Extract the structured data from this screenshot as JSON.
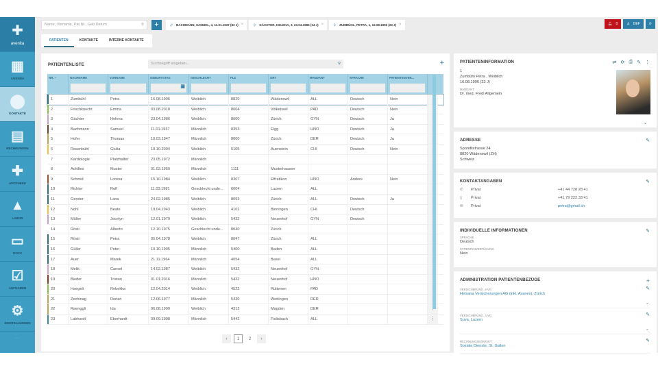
{
  "sidebar": {
    "logo": "avenita",
    "items": [
      {
        "label": "AGENDA",
        "icon": "calendar-icon",
        "glyph": "▦"
      },
      {
        "label": "KONTAKTE",
        "icon": "location-pin-icon",
        "glyph": "⬤",
        "active": true
      },
      {
        "label": "RECHNUNGEN",
        "icon": "calculator-icon",
        "glyph": "▤"
      },
      {
        "label": "APOTHEKE",
        "icon": "medical-cross-icon",
        "glyph": "✚"
      },
      {
        "label": "LABOR",
        "icon": "lab-chart-icon",
        "glyph": "▲"
      },
      {
        "label": "DOCS",
        "icon": "document-icon",
        "glyph": "▭"
      },
      {
        "label": "AUFGABEN",
        "icon": "task-checklist-icon",
        "glyph": "☑"
      },
      {
        "label": "EINSTELLUNGEN",
        "icon": "gear-icon",
        "glyph": "⚙"
      }
    ]
  },
  "topbar": {
    "search_placeholder": "Name, Vorname, Pat.Nr., Geb.Datum",
    "patient_tabs": [
      {
        "label": "BACHMANN, SAMUEL, 4, 11.01.1937 (83 J)",
        "gender": "♂"
      },
      {
        "label": "GÄCHTER, HELENA, 3, 23.04.1986 (34 J)",
        "gender": "♀"
      },
      {
        "label": "ZUMBÜHL, PETRA, 1, 16.08.1996 (23 J)",
        "gender": "♀"
      }
    ],
    "notifications": "0",
    "user": "DEF"
  },
  "subtabs": [
    "PATIENTEN",
    "KONTAKTE",
    "INTERNE KONTAKTE"
  ],
  "patientlist": {
    "title": "PATIENTENLISTE",
    "search_placeholder": "Suchbegriff eingeben...",
    "columns": [
      "NR.",
      "NACHNAME",
      "VORNAME",
      "GEBURTSTAG",
      "GESCHLECHT",
      "PLZ",
      "ORT",
      "MANDANT",
      "SPRACHE",
      "PATIENTENVER..."
    ],
    "rows": [
      [
        "1",
        "Zumbühl",
        "Petra",
        "16.08.1996",
        "Weiblich",
        "8820",
        "Wädenswil",
        "ALL",
        "Deutsch",
        "Nein",
        "#2e6f80"
      ],
      [
        "2",
        "Frischknecht",
        "Emma",
        "03.08.2018",
        "Weiblich",
        "8604",
        "Volketswil",
        "PAD",
        "Deutsch",
        "Nein",
        "#8bc34a"
      ],
      [
        "3",
        "Gächter",
        "Helena",
        "23.04.1986",
        "Weiblich",
        "8000",
        "Zürich",
        "GYN",
        "Deutsch",
        "Ja",
        "#c9a0c9"
      ],
      [
        "4",
        "Bachmann",
        "Samuel",
        "11.01.1937",
        "Männlich",
        "8353",
        "Elgg",
        "HNO",
        "Deutsch",
        "Ja",
        "#6e4420"
      ],
      [
        "5",
        "Hofer",
        "Thomas",
        "10.03.1947",
        "Männlich",
        "8000",
        "Zürich",
        "DER",
        "Deutsch",
        "Ja",
        "#c8a050"
      ],
      [
        "6",
        "Rosenbühl",
        "Giulia",
        "10.10.2004",
        "Weiblich",
        "5105",
        "Auenstein",
        "CHI",
        "Deutsch",
        "Nein",
        "#f0c040"
      ],
      [
        "7",
        "Kardiologie",
        "Platzhalter",
        "23.05.1972",
        "Männlich",
        "",
        "",
        "",
        "",
        "",
        ""
      ],
      [
        "8",
        "Achilles",
        "Muster",
        "01.02.1950",
        "Männlich",
        "1111",
        "Musterhausen",
        "",
        "",
        "",
        ""
      ],
      [
        "9",
        "Schmid",
        "Lorena",
        "15.10.1984",
        "Weiblich",
        "8307",
        "Effretikon",
        "HNO",
        "Andere",
        "Nein",
        "#a0522d"
      ],
      [
        "10",
        "Richter",
        "Rolf",
        "11.03.1981",
        "Geschlecht unde...",
        "6004",
        "Luzern",
        "ALL",
        "",
        "",
        "#2e6f80"
      ],
      [
        "11",
        "Gerster",
        "Lana",
        "24.02.1985",
        "Weiblich",
        "8093",
        "Zürich",
        "ALL",
        "Deutsch",
        "Ja",
        "#2e6f80"
      ],
      [
        "12",
        "Nohl",
        "Beate",
        "19.04.1943",
        "Weiblich",
        "4102",
        "Binningen",
        "CHI",
        "Deutsch",
        "",
        "#f0c040"
      ],
      [
        "13",
        "Müller",
        "Jocelyn",
        "12.01.1979",
        "Weiblich",
        "5432",
        "Neuenhof",
        "GYN",
        "Deutsch",
        "",
        "#c9a0c9"
      ],
      [
        "14",
        "Rösti",
        "Alberto",
        "12.10.1975",
        "Geschlecht unde...",
        "8040",
        "Zürich",
        "",
        "",
        "",
        ""
      ],
      [
        "15",
        "Rösti",
        "Petra",
        "05.04.1978",
        "Weiblich",
        "8047",
        "Zürich",
        "ALL",
        "",
        "",
        "#2e6f80"
      ],
      [
        "16",
        "Güller",
        "Peter",
        "10.10.1995",
        "Männlich",
        "5400",
        "Baden",
        "ALL",
        "",
        "",
        "#2e6f80"
      ],
      [
        "17",
        "Auer",
        "Marek",
        "21.11.1964",
        "Männlich",
        "4054",
        "Basel",
        "ALL",
        "",
        "",
        "#2e6f80"
      ],
      [
        "18",
        "Melik",
        "Cansel",
        "14.02.1987",
        "Weiblich",
        "5432",
        "Neuenhof",
        "GYN",
        "",
        "",
        "#d8a0c8"
      ],
      [
        "19",
        "Bieder",
        "Tristan",
        "01.01.2016",
        "Männlich",
        "5432",
        "Neuenhof",
        "HNO",
        "",
        "",
        "#8a3a1a"
      ],
      [
        "20",
        "Haegeli",
        "Rebekka",
        "12.04.2014",
        "Weiblich",
        "4522",
        "Rüttenen",
        "PAD",
        "",
        "",
        "#8bc34a"
      ],
      [
        "21",
        "Zechinag",
        "Dorian",
        "12.06.1977",
        "Männlich",
        "5430",
        "Wettingen",
        "DER",
        "",
        "",
        "#c8a050"
      ],
      [
        "22",
        "Raenggli",
        "Ida",
        "06.08.1990",
        "Weiblich",
        "4312",
        "Magden",
        "DER",
        "",
        "",
        "#c8a050"
      ],
      [
        "23",
        "Labhardt",
        "Eberhardt",
        "09.09.1998",
        "Männlich",
        "5442",
        "Fislisbach",
        "ALL",
        "",
        "",
        "#3a8aa0"
      ]
    ],
    "pages": [
      "1",
      "2"
    ],
    "current_page": 1
  },
  "patientinfo": {
    "title": "PATIENTENINFORMATION",
    "nr": "1",
    "name_line": "Zumbühl Petra , Weiblich",
    "birth": "16.08.1996 (23 J)",
    "mandant_label": "MANDANT",
    "mandant": "Dr. med. Fredi Allgemein"
  },
  "adresse": {
    "title": "ADRESSE",
    "lines": [
      "Spondlistrasse 24",
      "8820 Wädenswil (ZH)",
      "Schweiz"
    ]
  },
  "kontakt": {
    "title": "KONTAKTANGABEN",
    "rows": [
      {
        "icon": "phone-icon",
        "g": "✆",
        "type": "Privat",
        "value": "+41 44 728 28 41"
      },
      {
        "icon": "mobile-icon",
        "g": "▯",
        "type": "Privat",
        "value": "+41 79 222 33 41"
      },
      {
        "icon": "mail-icon",
        "g": "✉",
        "type": "Privat",
        "value": "petra@gmail.ch"
      }
    ]
  },
  "individuell": {
    "title": "INDIVIDUELLE INFORMATIONEN",
    "sprache_label": "SPRACHE",
    "sprache": "Deutsch",
    "pv_label": "PATIENTENVERFÜGUNG",
    "pv": "Nein"
  },
  "admin": {
    "title": "ADMINISTRATION PATIENTENBEZÜGE",
    "items": [
      {
        "label": "VERSICHERUNG , KVG",
        "value": "Helsana Versicherungen AG (inkl. Avanex), Zürich"
      },
      {
        "label": "VERSICHERUNG , UVG",
        "value": "Suva, Luzern"
      },
      {
        "label": "RECHNUNGSKONTAKT",
        "value": "Soziale Dienste, St. Gallen"
      }
    ]
  },
  "colors": {
    "accent": "#2e7fa8",
    "sidebar": "#3d9dc3",
    "alert": "#c0141c"
  }
}
